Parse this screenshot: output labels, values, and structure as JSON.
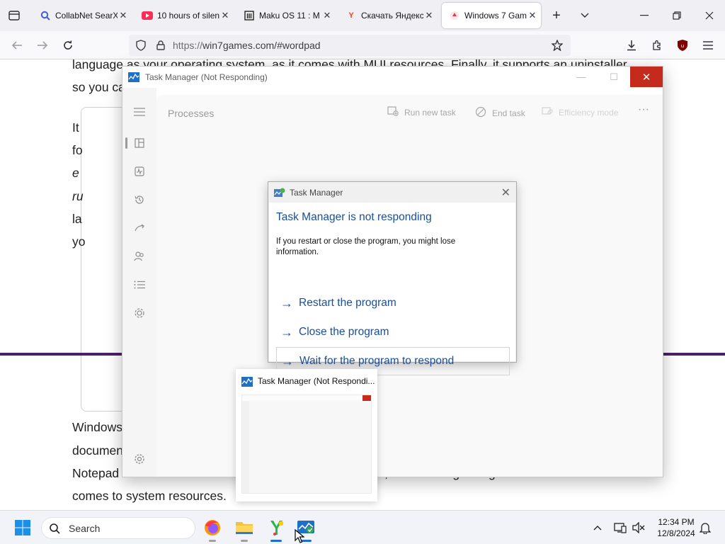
{
  "browser": {
    "tabs": [
      {
        "title": "CollabNet SearX",
        "favicon_color": "#3d5fd9"
      },
      {
        "title": "10 hours of silen",
        "favicon_color": "#ff2d55"
      },
      {
        "title": "Maku OS 11 : M",
        "favicon_color": "#222222"
      },
      {
        "title": "Скачать Яндекс",
        "favicon_color": "#fc3f1d"
      },
      {
        "title": "Windows 7 Gam",
        "favicon_color": "#d8414c"
      }
    ],
    "url_prefix": "https://",
    "url": "win7games.com/#wordpad"
  },
  "webpage": {
    "line1": "language as your operating system, as it comes with MUI resources. Finally, it supports an uninstaller",
    "line2": "so you ca",
    "col_lines": [
      "It",
      "fo",
      "e",
      "ru",
      "la",
      "yo"
    ],
    "bottom_lines": [
      "Windows",
      "documen",
      "Notepad without these  additions.  It's smaller, starts faster, and more lightweight when it",
      "comes to system resources."
    ],
    "accent_color": "#4b2264"
  },
  "task_manager": {
    "title": "Task Manager (Not Responding)",
    "page_title": "Processes",
    "toolbar": {
      "run_new_task": "Run new task",
      "end_task": "End task",
      "efficiency_mode": "Efficiency mode",
      "more": "···"
    }
  },
  "dialog": {
    "title": "Task Manager",
    "heading": "Task Manager is not responding",
    "message": "If you restart or close the program, you might lose information.",
    "options": [
      "Restart the program",
      "Close the program",
      "Wait for the program to respond"
    ]
  },
  "preview": {
    "title": "Task Manager (Not Respondi..."
  },
  "taskbar": {
    "search_placeholder": "Search",
    "time": "12:34 PM",
    "date": "12/8/2024"
  }
}
